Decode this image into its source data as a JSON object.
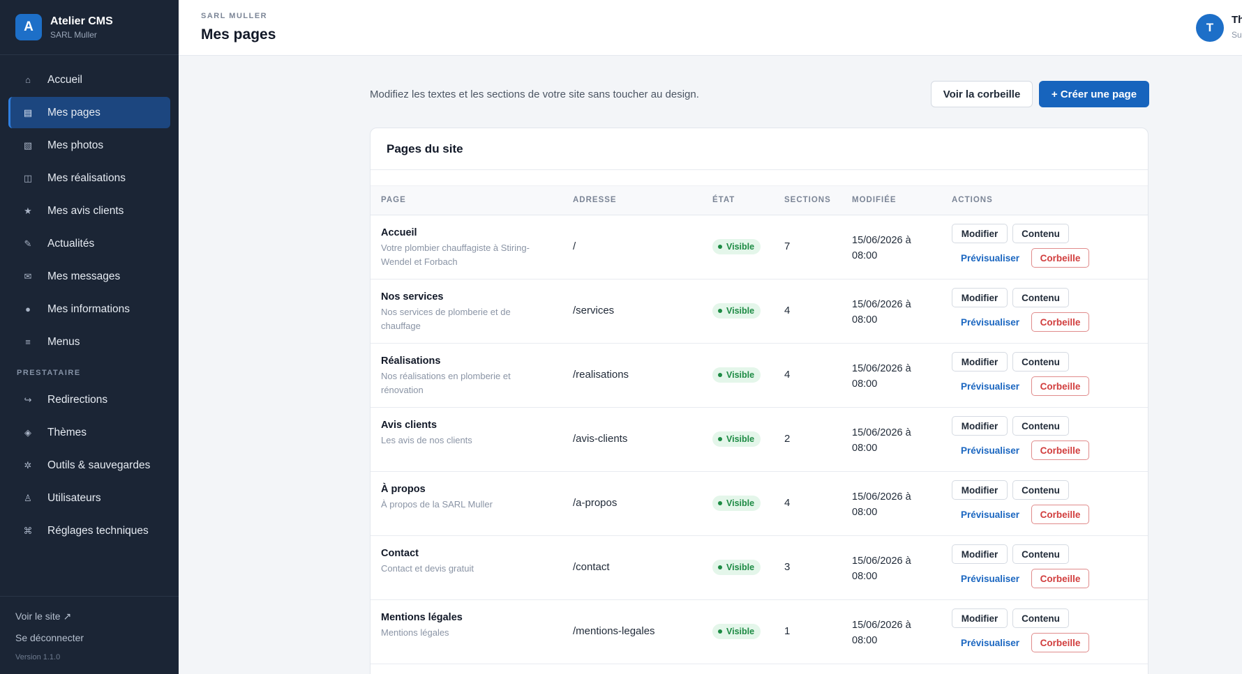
{
  "sidebar": {
    "brand_initial": "A",
    "brand_name": "Atelier CMS",
    "brand_sub": "SARL Muller",
    "items": [
      {
        "label": "Accueil",
        "icon": "⌂"
      },
      {
        "label": "Mes pages",
        "icon": "▤"
      },
      {
        "label": "Mes photos",
        "icon": "▧"
      },
      {
        "label": "Mes réalisations",
        "icon": "◫"
      },
      {
        "label": "Mes avis clients",
        "icon": "★"
      },
      {
        "label": "Actualités",
        "icon": "✎"
      },
      {
        "label": "Mes messages",
        "icon": "✉"
      },
      {
        "label": "Mes informations",
        "icon": "●"
      },
      {
        "label": "Menus",
        "icon": "≡"
      }
    ],
    "section_label": "PRESTATAIRE",
    "presta_items": [
      {
        "label": "Redirections",
        "icon": "↪"
      },
      {
        "label": "Thèmes",
        "icon": "◈"
      },
      {
        "label": "Outils & sauvegardes",
        "icon": "✲"
      },
      {
        "label": "Utilisateurs",
        "icon": "♙"
      },
      {
        "label": "Réglages techniques",
        "icon": "⌘"
      }
    ],
    "view_site": "Voir le site ↗",
    "logout": "Se déconnecter",
    "version": "Version 1.1.0"
  },
  "header": {
    "company": "SARL MULLER",
    "title": "Mes pages",
    "user_initial": "T",
    "user_name": "Th",
    "user_role": "Su"
  },
  "main": {
    "intro": "Modifiez les textes et les sections de votre site sans toucher au design.",
    "trash_button": "Voir la corbeille",
    "create_button": "+ Créer une page",
    "card_title": "Pages du site",
    "columns": [
      "PAGE",
      "ADRESSE",
      "ÉTAT",
      "SECTIONS",
      "MODIFIÉE",
      "ACTIONS"
    ],
    "actions": {
      "edit": "Modifier",
      "content": "Contenu",
      "preview": "Prévisualiser",
      "trash": "Corbeille"
    },
    "rows": [
      {
        "title": "Accueil",
        "desc": "Votre plombier chauffagiste à Stiring-Wendel et Forbach",
        "address": "/",
        "status": "Visible",
        "sections": "7",
        "modified": "15/06/2026 à 08:00"
      },
      {
        "title": "Nos services",
        "desc": "Nos services de plomberie et de chauffage",
        "address": "/services",
        "status": "Visible",
        "sections": "4",
        "modified": "15/06/2026 à 08:00"
      },
      {
        "title": "Réalisations",
        "desc": "Nos réalisations en plomberie et rénovation",
        "address": "/realisations",
        "status": "Visible",
        "sections": "4",
        "modified": "15/06/2026 à 08:00"
      },
      {
        "title": "Avis clients",
        "desc": "Les avis de nos clients",
        "address": "/avis-clients",
        "status": "Visible",
        "sections": "2",
        "modified": "15/06/2026 à 08:00"
      },
      {
        "title": "À propos",
        "desc": "À propos de la SARL Muller",
        "address": "/a-propos",
        "status": "Visible",
        "sections": "4",
        "modified": "15/06/2026 à 08:00"
      },
      {
        "title": "Contact",
        "desc": "Contact et devis gratuit",
        "address": "/contact",
        "status": "Visible",
        "sections": "3",
        "modified": "15/06/2026 à 08:00"
      },
      {
        "title": "Mentions légales",
        "desc": "Mentions légales",
        "address": "/mentions-legales",
        "status": "Visible",
        "sections": "1",
        "modified": "15/06/2026 à 08:00"
      }
    ]
  }
}
